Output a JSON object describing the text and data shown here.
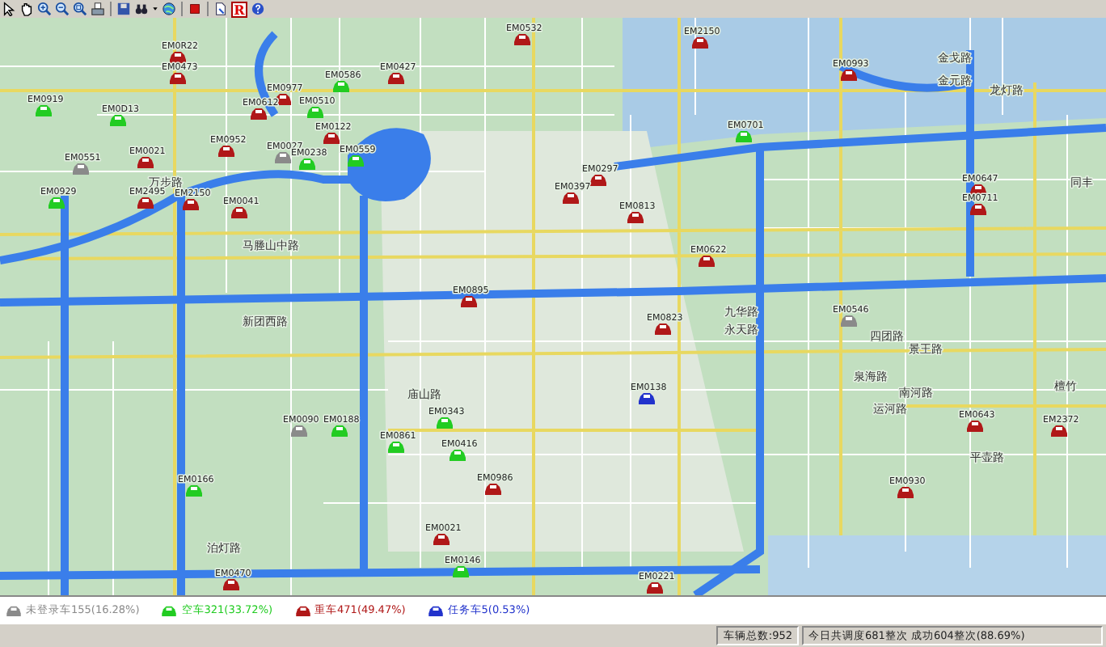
{
  "toolbar": {
    "report_button": "R"
  },
  "map": {
    "road_names": [
      "万步路",
      "马塍山中路",
      "新团西路",
      "庙山路",
      "泊灯路",
      "九华路",
      "永天路",
      "四团路",
      "景王路",
      "泉海路",
      "南河路",
      "运河路",
      "平壶路",
      "龙灯路",
      "金戈路",
      "金元路",
      "同丰",
      "檀竹"
    ],
    "vehicles": [
      {
        "label": "EM0532",
        "kind": "loaded"
      },
      {
        "label": "EM2150",
        "kind": "loaded"
      },
      {
        "label": "EM0R22",
        "kind": "loaded"
      },
      {
        "label": "EM0993",
        "kind": "loaded"
      },
      {
        "label": "EM0473",
        "kind": "loaded"
      },
      {
        "label": "EM0427",
        "kind": "loaded"
      },
      {
        "label": "EM0586",
        "kind": "empty"
      },
      {
        "label": "EM0977",
        "kind": "loaded"
      },
      {
        "label": "EM0919",
        "kind": "empty"
      },
      {
        "label": "EM0612",
        "kind": "loaded"
      },
      {
        "label": "EM0510",
        "kind": "empty"
      },
      {
        "label": "EM0D13",
        "kind": "empty"
      },
      {
        "label": "EM0701",
        "kind": "empty"
      },
      {
        "label": "EM0122",
        "kind": "loaded"
      },
      {
        "label": "EM0551",
        "kind": "offline"
      },
      {
        "label": "EM0021",
        "kind": "loaded"
      },
      {
        "label": "EM0952",
        "kind": "loaded"
      },
      {
        "label": "EM0027",
        "kind": "offline"
      },
      {
        "label": "EM0238",
        "kind": "empty"
      },
      {
        "label": "EM0559",
        "kind": "empty"
      },
      {
        "label": "EM0297",
        "kind": "loaded"
      },
      {
        "label": "EM0647",
        "kind": "loaded"
      },
      {
        "label": "EM0397",
        "kind": "loaded"
      },
      {
        "label": "EM0929",
        "kind": "empty"
      },
      {
        "label": "EM2495",
        "kind": "loaded"
      },
      {
        "label": "EM2150",
        "kind": "loaded"
      },
      {
        "label": "EM0711",
        "kind": "loaded"
      },
      {
        "label": "EM0041",
        "kind": "loaded"
      },
      {
        "label": "EM0813",
        "kind": "loaded"
      },
      {
        "label": "EM0622",
        "kind": "loaded"
      },
      {
        "label": "EM0895",
        "kind": "loaded"
      },
      {
        "label": "EM0546",
        "kind": "offline"
      },
      {
        "label": "EM0823",
        "kind": "loaded"
      },
      {
        "label": "EM0138",
        "kind": "task"
      },
      {
        "label": "EM0343",
        "kind": "empty"
      },
      {
        "label": "EM0643",
        "kind": "loaded"
      },
      {
        "label": "EM0090",
        "kind": "offline"
      },
      {
        "label": "EM0188",
        "kind": "empty"
      },
      {
        "label": "EM2372",
        "kind": "loaded"
      },
      {
        "label": "EM0861",
        "kind": "empty"
      },
      {
        "label": "EM0416",
        "kind": "empty"
      },
      {
        "label": "EM0166",
        "kind": "empty"
      },
      {
        "label": "EM0986",
        "kind": "loaded"
      },
      {
        "label": "EM0930",
        "kind": "loaded"
      },
      {
        "label": "EM0021",
        "kind": "loaded"
      },
      {
        "label": "EM0146",
        "kind": "empty"
      },
      {
        "label": "EM0470",
        "kind": "loaded"
      },
      {
        "label": "EM0221",
        "kind": "loaded"
      }
    ]
  },
  "legend": [
    {
      "kind": "offline",
      "text": "未登录车155(16.28%)"
    },
    {
      "kind": "empty",
      "text": "空车321(33.72%)"
    },
    {
      "kind": "loaded",
      "text": "重车471(49.47%)"
    },
    {
      "kind": "task",
      "text": "任务车5(0.53%)"
    }
  ],
  "status_bar": {
    "total": "车辆总数:952",
    "dispatch": "今日共调度681整次 成功604整次(88.69%)"
  }
}
